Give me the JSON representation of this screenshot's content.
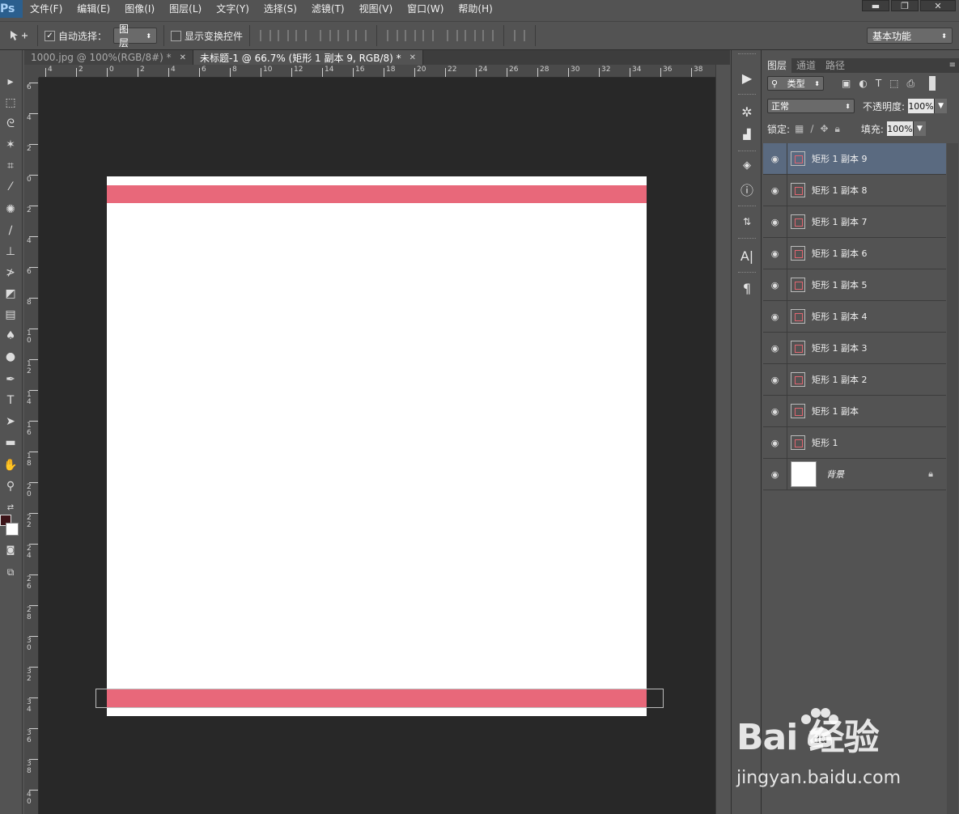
{
  "menubar": {
    "logo": "Ps",
    "items": [
      "文件(F)",
      "编辑(E)",
      "图像(I)",
      "图层(L)",
      "文字(Y)",
      "选择(S)",
      "滤镜(T)",
      "视图(V)",
      "窗口(W)",
      "帮助(H)"
    ],
    "window_controls": [
      "▬",
      "❐",
      "✕"
    ]
  },
  "options": {
    "auto_select_label": "自动选择：",
    "auto_select_checked": true,
    "auto_select_target": "图层",
    "show_transform_label": "显示变换控件",
    "show_transform_checked": false,
    "workspace": "基本功能"
  },
  "tabs": [
    {
      "label": "1000.jpg @ 100%(RGB/8#) *",
      "active": false
    },
    {
      "label": "未标题-1 @ 66.7% (矩形 1 副本 9, RGB/8) *",
      "active": true
    }
  ],
  "ruler": {
    "top_labels": [
      "4",
      "2",
      "0",
      "2",
      "4",
      "6",
      "8",
      "10",
      "12",
      "14",
      "16",
      "18",
      "20",
      "22",
      "24",
      "26",
      "28",
      "30",
      "32",
      "34",
      "36",
      "38"
    ],
    "left_labels": [
      "6",
      "4",
      "2",
      "0",
      "2",
      "4",
      "6",
      "8",
      "10",
      "12",
      "14",
      "16",
      "18",
      "20",
      "22",
      "24",
      "26",
      "28",
      "30",
      "32",
      "34",
      "36",
      "38",
      "40"
    ]
  },
  "document": {
    "stripe_color": "#E8687A",
    "background": "#FFFFFF"
  },
  "layers_panel": {
    "tabs": [
      "图层",
      "通道",
      "路径"
    ],
    "filter_label": "类型",
    "blend_mode": "正常",
    "opacity_label": "不透明度:",
    "opacity_value": "100%",
    "lock_label": "锁定:",
    "fill_label": "填充:",
    "fill_value": "100%",
    "layers": [
      {
        "name": "矩形 1 副本 9",
        "selected": true
      },
      {
        "name": "矩形 1 副本 8",
        "selected": false
      },
      {
        "name": "矩形 1 副本 7",
        "selected": false
      },
      {
        "name": "矩形 1 副本 6",
        "selected": false
      },
      {
        "name": "矩形 1 副本 5",
        "selected": false
      },
      {
        "name": "矩形 1 副本 4",
        "selected": false
      },
      {
        "name": "矩形 1 副本 3",
        "selected": false
      },
      {
        "name": "矩形 1 副本 2",
        "selected": false
      },
      {
        "name": "矩形 1 副本",
        "selected": false
      },
      {
        "name": "矩形 1",
        "selected": false
      }
    ],
    "background_layer": "背景"
  },
  "watermark": {
    "logo_text": "Bai  经验",
    "url": "jingyan.baidu.com"
  }
}
